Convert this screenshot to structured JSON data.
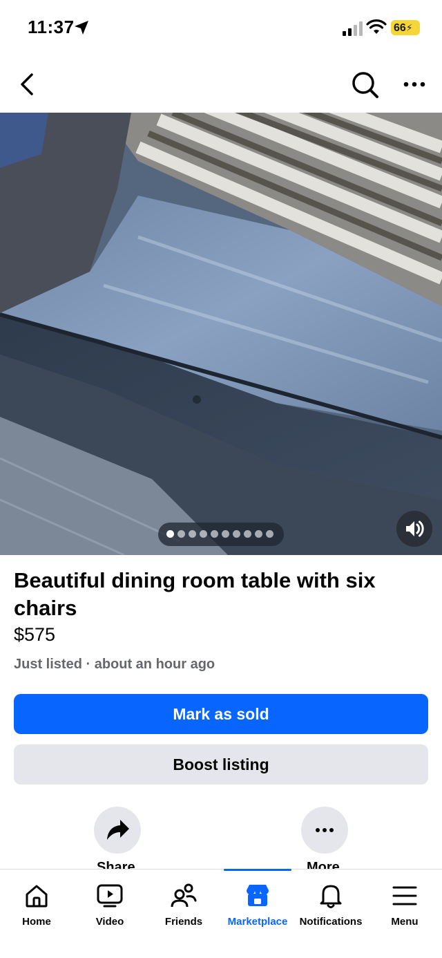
{
  "status_bar": {
    "time": "11:37",
    "battery": "66"
  },
  "listing": {
    "title": "Beautiful dining room table with six chairs",
    "price": "$575",
    "meta": "Just listed · about an hour ago",
    "media_count": 10,
    "media_active_index": 0
  },
  "buttons": {
    "mark_sold": "Mark as sold",
    "boost": "Boost listing"
  },
  "actions": {
    "share": "Share",
    "more": "More"
  },
  "tabs": [
    {
      "label": "Home",
      "icon": "home-icon"
    },
    {
      "label": "Video",
      "icon": "video-icon"
    },
    {
      "label": "Friends",
      "icon": "friends-icon"
    },
    {
      "label": "Marketplace",
      "icon": "marketplace-icon"
    },
    {
      "label": "Notifications",
      "icon": "bell-icon"
    },
    {
      "label": "Menu",
      "icon": "menu-icon"
    }
  ],
  "colors": {
    "accent": "#0866ff",
    "secondary_button": "#e4e6eb",
    "muted_text": "#65676b",
    "battery": "#f4d638"
  }
}
